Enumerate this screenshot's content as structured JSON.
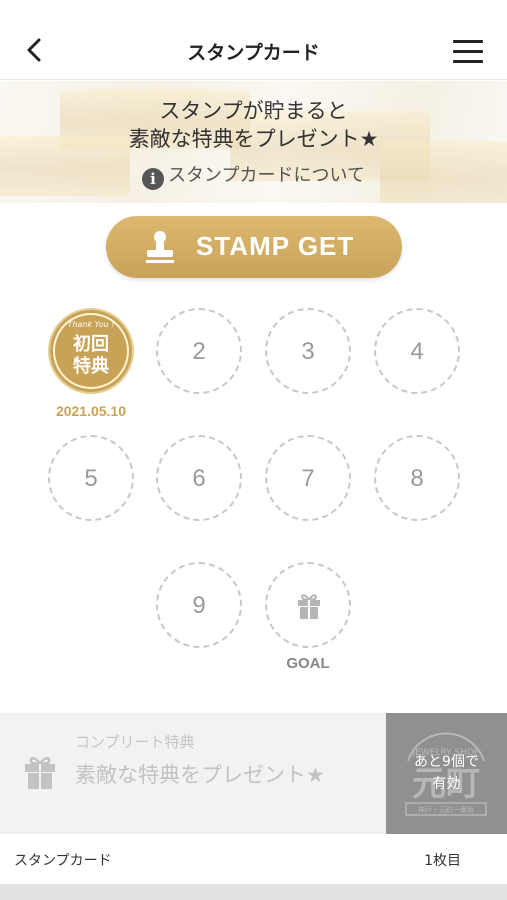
{
  "header": {
    "title": "スタンプカード",
    "back_icon": "chevron-left-icon",
    "menu_icon": "hamburger-menu-icon"
  },
  "banner": {
    "line1": "スタンプが貯まると",
    "line2": "素敵な特典をプレゼント★",
    "info_link": "スタンプカードについて",
    "info_icon": "info-icon"
  },
  "stamp_button": {
    "label": "STAMP GET",
    "icon": "stamp-icon",
    "color": "#c9a35a"
  },
  "stamp_card": {
    "first": {
      "top_text": "Thank You !",
      "main_text_1": "初回",
      "main_text_2": "特典",
      "date": "2021.05.10",
      "color": "#c8a257"
    },
    "slots": [
      "2",
      "3",
      "4",
      "5",
      "6",
      "7",
      "8",
      "9"
    ],
    "goal_label": "GOAL",
    "goal_icon": "gift-icon"
  },
  "complete": {
    "title": "コンプリート特典",
    "description": "素敵な特典をプレゼント★",
    "remaining_line1": "あと9個で",
    "remaining_line2": "有効",
    "logo_text": "元町",
    "logo_sub": "JEWELRY SHOP",
    "logo_footer": "神戸・元町一番街",
    "icon": "gift-icon"
  },
  "footer": {
    "left": "スタンプカード",
    "right": "1枚目"
  }
}
